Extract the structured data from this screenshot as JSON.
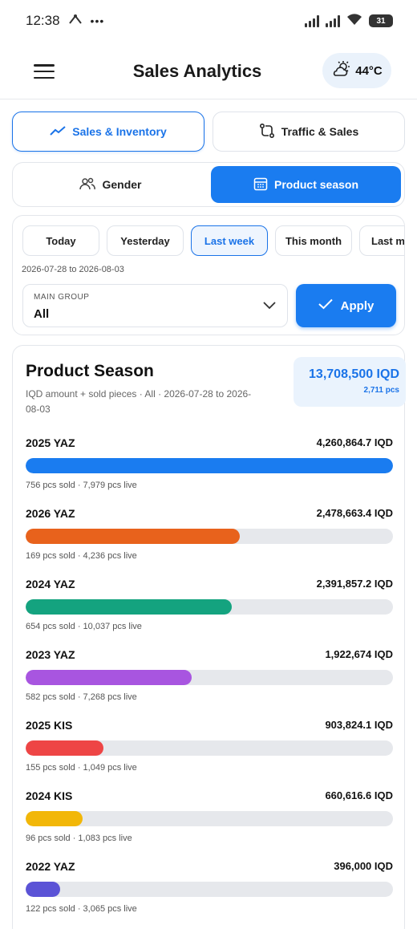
{
  "status_bar": {
    "time": "12:38",
    "battery": "31"
  },
  "header": {
    "title": "Sales Analytics",
    "temperature": "44°C"
  },
  "tabs": [
    {
      "label": "Sales & Inventory",
      "icon": "trend-line-icon",
      "active": true
    },
    {
      "label": "Traffic & Sales",
      "icon": "transfer-icon",
      "active": false
    }
  ],
  "segments": [
    {
      "label": "Gender",
      "icon": "users-icon",
      "active": false
    },
    {
      "label": "Product season",
      "icon": "calendar-icon",
      "active": true
    }
  ],
  "filters": {
    "periods": [
      "Today",
      "Yesterday",
      "Last week",
      "This month",
      "Last month"
    ],
    "active_period": "Last week",
    "date_range": "2026-07-28 to 2026-08-03",
    "group_label": "MAIN GROUP",
    "group_value": "All",
    "apply_label": "Apply"
  },
  "season": {
    "title": "Product Season",
    "subtitle": "IQD amount + sold pieces · All · 2026-07-28 to 2026-08-03",
    "total_amount": "13,708,500 IQD",
    "total_pcs": "2,711 pcs",
    "rows": [
      {
        "name": "2025 YAZ",
        "amount": "4,260,864.7 IQD",
        "meta": "756 pcs sold · 7,979 pcs live",
        "share": 1.0,
        "color": "#1a7cf0"
      },
      {
        "name": "2026 YAZ",
        "amount": "2,478,663.4 IQD",
        "meta": "169 pcs sold · 4,236 pcs live",
        "share": 0.582,
        "color": "#e8621c"
      },
      {
        "name": "2024 YAZ",
        "amount": "2,391,857.2 IQD",
        "meta": "654 pcs sold · 10,037 pcs live",
        "share": 0.561,
        "color": "#14a37f"
      },
      {
        "name": "2023 YAZ",
        "amount": "1,922,674 IQD",
        "meta": "582 pcs sold · 7,268 pcs live",
        "share": 0.451,
        "color": "#a855e0"
      },
      {
        "name": "2025 KIS",
        "amount": "903,824.1 IQD",
        "meta": "155 pcs sold · 1,049 pcs live",
        "share": 0.212,
        "color": "#ee4545"
      },
      {
        "name": "2024 KIS",
        "amount": "660,616.6 IQD",
        "meta": "96 pcs sold · 1,083 pcs live",
        "share": 0.155,
        "color": "#f2b708"
      },
      {
        "name": "2022 YAZ",
        "amount": "396,000 IQD",
        "meta": "122 pcs sold · 3,065 pcs live",
        "share": 0.093,
        "color": "#5b53d6"
      }
    ]
  }
}
